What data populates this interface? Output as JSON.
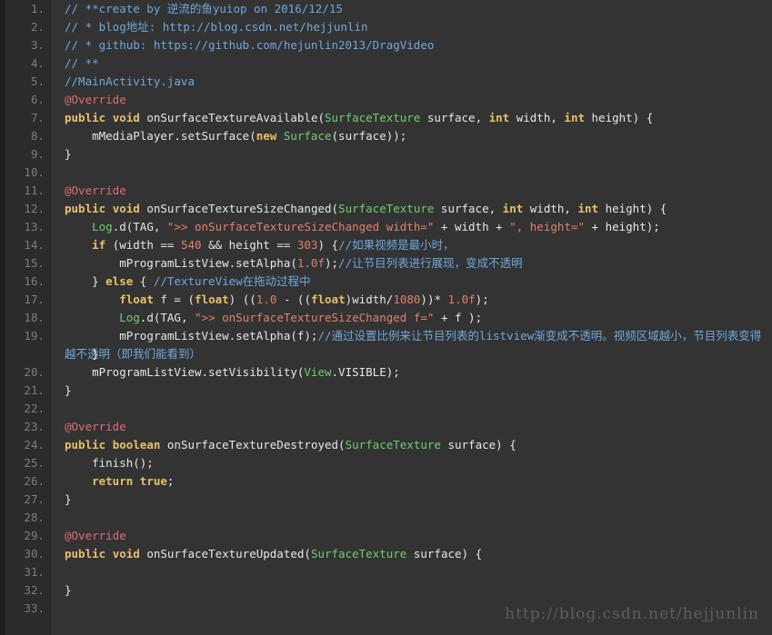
{
  "editor": {
    "theme_background": "#333333",
    "gutter_background": "#2b2b2b",
    "frame_color": "#1e1e1e",
    "gutter_text_color": "#7d7d7d",
    "default_text_color": "#e6e6e6",
    "language": "Java"
  },
  "colors": {
    "comment": "#6fa8dc",
    "keyword": "#e8c06a",
    "type": "#6fcf6f",
    "string": "#e0806e",
    "number": "#e0806e",
    "annotation": "#e06c75",
    "plain": "#e6e6e6"
  },
  "watermark": {
    "text": "http://blog.csdn.net/hejjunlin"
  },
  "line_numbers": [
    "1.",
    "2.",
    "3.",
    "4.",
    "5.",
    "6.",
    "7.",
    "8.",
    "9.",
    "10.",
    "11.",
    "12.",
    "13.",
    "14.",
    "15.",
    "16.",
    "17.",
    "18.",
    "19.",
    "",
    "20.",
    "21.",
    "22.",
    "23.",
    "24.",
    "25.",
    "26.",
    "27.",
    "28.",
    "29.",
    "30.",
    "31.",
    "32.",
    "33."
  ],
  "lines": [
    {
      "n": "1.",
      "tokens": [
        {
          "c": "comment",
          "t": "// **create by 逆流的鱼yuiop on 2016/12/15"
        }
      ]
    },
    {
      "n": "2.",
      "tokens": [
        {
          "c": "comment",
          "t": "// * blog地址: http://blog.csdn.net/hejjunlin"
        }
      ]
    },
    {
      "n": "3.",
      "tokens": [
        {
          "c": "comment",
          "t": "// * github: https://github.com/hejunlin2013/DragVideo"
        }
      ]
    },
    {
      "n": "4.",
      "tokens": [
        {
          "c": "comment",
          "t": "// **"
        }
      ]
    },
    {
      "n": "5.",
      "tokens": [
        {
          "c": "comment",
          "t": "//MainActivity.java"
        }
      ]
    },
    {
      "n": "6.",
      "tokens": [
        {
          "c": "anno",
          "t": "@Override"
        }
      ]
    },
    {
      "n": "7.",
      "tokens": [
        {
          "c": "keyword",
          "t": "public"
        },
        {
          "c": "plain",
          "t": " "
        },
        {
          "c": "keyword",
          "t": "void"
        },
        {
          "c": "plain",
          "t": " onSurfaceTextureAvailable("
        },
        {
          "c": "type",
          "t": "SurfaceTexture"
        },
        {
          "c": "plain",
          "t": " surface, "
        },
        {
          "c": "keyword",
          "t": "int"
        },
        {
          "c": "plain",
          "t": " width, "
        },
        {
          "c": "keyword",
          "t": "int"
        },
        {
          "c": "plain",
          "t": " height) {"
        }
      ]
    },
    {
      "n": "8.",
      "tokens": [
        {
          "c": "plain",
          "t": "    mMediaPlayer.setSurface("
        },
        {
          "c": "keyword",
          "t": "new"
        },
        {
          "c": "plain",
          "t": " "
        },
        {
          "c": "type",
          "t": "Surface"
        },
        {
          "c": "plain",
          "t": "(surface));"
        }
      ]
    },
    {
      "n": "9.",
      "tokens": [
        {
          "c": "plain",
          "t": "}"
        }
      ]
    },
    {
      "n": "10.",
      "tokens": [
        {
          "c": "plain",
          "t": ""
        }
      ]
    },
    {
      "n": "11.",
      "tokens": [
        {
          "c": "anno",
          "t": "@Override"
        }
      ]
    },
    {
      "n": "12.",
      "tokens": [
        {
          "c": "keyword",
          "t": "public"
        },
        {
          "c": "plain",
          "t": " "
        },
        {
          "c": "keyword",
          "t": "void"
        },
        {
          "c": "plain",
          "t": " onSurfaceTextureSizeChanged("
        },
        {
          "c": "type",
          "t": "SurfaceTexture"
        },
        {
          "c": "plain",
          "t": " surface, "
        },
        {
          "c": "keyword",
          "t": "int"
        },
        {
          "c": "plain",
          "t": " width, "
        },
        {
          "c": "keyword",
          "t": "int"
        },
        {
          "c": "plain",
          "t": " height) {"
        }
      ]
    },
    {
      "n": "13.",
      "tokens": [
        {
          "c": "plain",
          "t": "    "
        },
        {
          "c": "type",
          "t": "Log"
        },
        {
          "c": "plain",
          "t": ".d(TAG, "
        },
        {
          "c": "string",
          "t": "\">> onSurfaceTextureSizeChanged width=\""
        },
        {
          "c": "plain",
          "t": " + width + "
        },
        {
          "c": "string",
          "t": "\", height=\""
        },
        {
          "c": "plain",
          "t": " + height);"
        }
      ]
    },
    {
      "n": "14.",
      "tokens": [
        {
          "c": "plain",
          "t": "    "
        },
        {
          "c": "keyword",
          "t": "if"
        },
        {
          "c": "plain",
          "t": " (width == "
        },
        {
          "c": "number",
          "t": "540"
        },
        {
          "c": "plain",
          "t": " && height == "
        },
        {
          "c": "number",
          "t": "303"
        },
        {
          "c": "plain",
          "t": ") {"
        },
        {
          "c": "comment",
          "t": "//如果视频是最小时，"
        }
      ]
    },
    {
      "n": "15.",
      "tokens": [
        {
          "c": "plain",
          "t": "        mProgramListView.setAlpha("
        },
        {
          "c": "number",
          "t": "1.0f"
        },
        {
          "c": "plain",
          "t": ");"
        },
        {
          "c": "comment",
          "t": "//让节目列表进行展现，变成不透明"
        }
      ]
    },
    {
      "n": "16.",
      "tokens": [
        {
          "c": "plain",
          "t": "    } "
        },
        {
          "c": "keyword",
          "t": "else"
        },
        {
          "c": "plain",
          "t": " { "
        },
        {
          "c": "comment",
          "t": "//TextureView在拖动过程中"
        }
      ]
    },
    {
      "n": "17.",
      "tokens": [
        {
          "c": "plain",
          "t": "        "
        },
        {
          "c": "keyword",
          "t": "float"
        },
        {
          "c": "plain",
          "t": " f = ("
        },
        {
          "c": "keyword",
          "t": "float"
        },
        {
          "c": "plain",
          "t": ") (("
        },
        {
          "c": "number",
          "t": "1.0"
        },
        {
          "c": "plain",
          "t": " - (("
        },
        {
          "c": "keyword",
          "t": "float"
        },
        {
          "c": "plain",
          "t": ")width/"
        },
        {
          "c": "number",
          "t": "1080"
        },
        {
          "c": "plain",
          "t": "))* "
        },
        {
          "c": "number",
          "t": "1.0f"
        },
        {
          "c": "plain",
          "t": ");"
        }
      ]
    },
    {
      "n": "18.",
      "tokens": [
        {
          "c": "plain",
          "t": "        "
        },
        {
          "c": "type",
          "t": "Log"
        },
        {
          "c": "plain",
          "t": ".d(TAG, "
        },
        {
          "c": "string",
          "t": "\">> onSurfaceTextureSizeChanged f=\""
        },
        {
          "c": "plain",
          "t": " + f );"
        }
      ]
    },
    {
      "n": "19.",
      "wrap": true,
      "tokens": [
        {
          "c": "plain",
          "t": "        mProgramListView.setAlpha(f);"
        },
        {
          "c": "comment",
          "t": "//通过设置比例来让节目列表的listview渐变成不透明。视频区域越小，节目列表变得越不透明（即我们能看到）"
        }
      ]
    },
    {
      "n": "20.",
      "tokens": [
        {
          "c": "plain",
          "t": "    }"
        }
      ]
    },
    {
      "n": "21.",
      "tokens": [
        {
          "c": "plain",
          "t": "    mProgramListView.setVisibility("
        },
        {
          "c": "type",
          "t": "View"
        },
        {
          "c": "plain",
          "t": ".VISIBLE);"
        }
      ]
    },
    {
      "n": "22.",
      "tokens": [
        {
          "c": "plain",
          "t": "}"
        }
      ]
    },
    {
      "n": "23.",
      "tokens": [
        {
          "c": "plain",
          "t": ""
        }
      ]
    },
    {
      "n": "24.",
      "tokens": [
        {
          "c": "anno",
          "t": "@Override"
        }
      ]
    },
    {
      "n": "25.",
      "tokens": [
        {
          "c": "keyword",
          "t": "public"
        },
        {
          "c": "plain",
          "t": " "
        },
        {
          "c": "keyword",
          "t": "boolean"
        },
        {
          "c": "plain",
          "t": " onSurfaceTextureDestroyed("
        },
        {
          "c": "type",
          "t": "SurfaceTexture"
        },
        {
          "c": "plain",
          "t": " surface) {"
        }
      ]
    },
    {
      "n": "26.",
      "tokens": [
        {
          "c": "plain",
          "t": "    finish();"
        }
      ]
    },
    {
      "n": "27.",
      "tokens": [
        {
          "c": "plain",
          "t": "    "
        },
        {
          "c": "keyword",
          "t": "return"
        },
        {
          "c": "plain",
          "t": " "
        },
        {
          "c": "keyword",
          "t": "true"
        },
        {
          "c": "plain",
          "t": ";"
        }
      ]
    },
    {
      "n": "28.",
      "tokens": [
        {
          "c": "plain",
          "t": "}"
        }
      ]
    },
    {
      "n": "29.",
      "tokens": [
        {
          "c": "plain",
          "t": ""
        }
      ]
    },
    {
      "n": "30.",
      "tokens": [
        {
          "c": "anno",
          "t": "@Override"
        }
      ]
    },
    {
      "n": "31.",
      "tokens": [
        {
          "c": "keyword",
          "t": "public"
        },
        {
          "c": "plain",
          "t": " "
        },
        {
          "c": "keyword",
          "t": "void"
        },
        {
          "c": "plain",
          "t": " onSurfaceTextureUpdated("
        },
        {
          "c": "type",
          "t": "SurfaceTexture"
        },
        {
          "c": "plain",
          "t": " surface) {"
        }
      ]
    },
    {
      "n": "32.",
      "tokens": [
        {
          "c": "plain",
          "t": ""
        }
      ]
    },
    {
      "n": "33.",
      "tokens": [
        {
          "c": "plain",
          "t": "}"
        }
      ]
    }
  ]
}
